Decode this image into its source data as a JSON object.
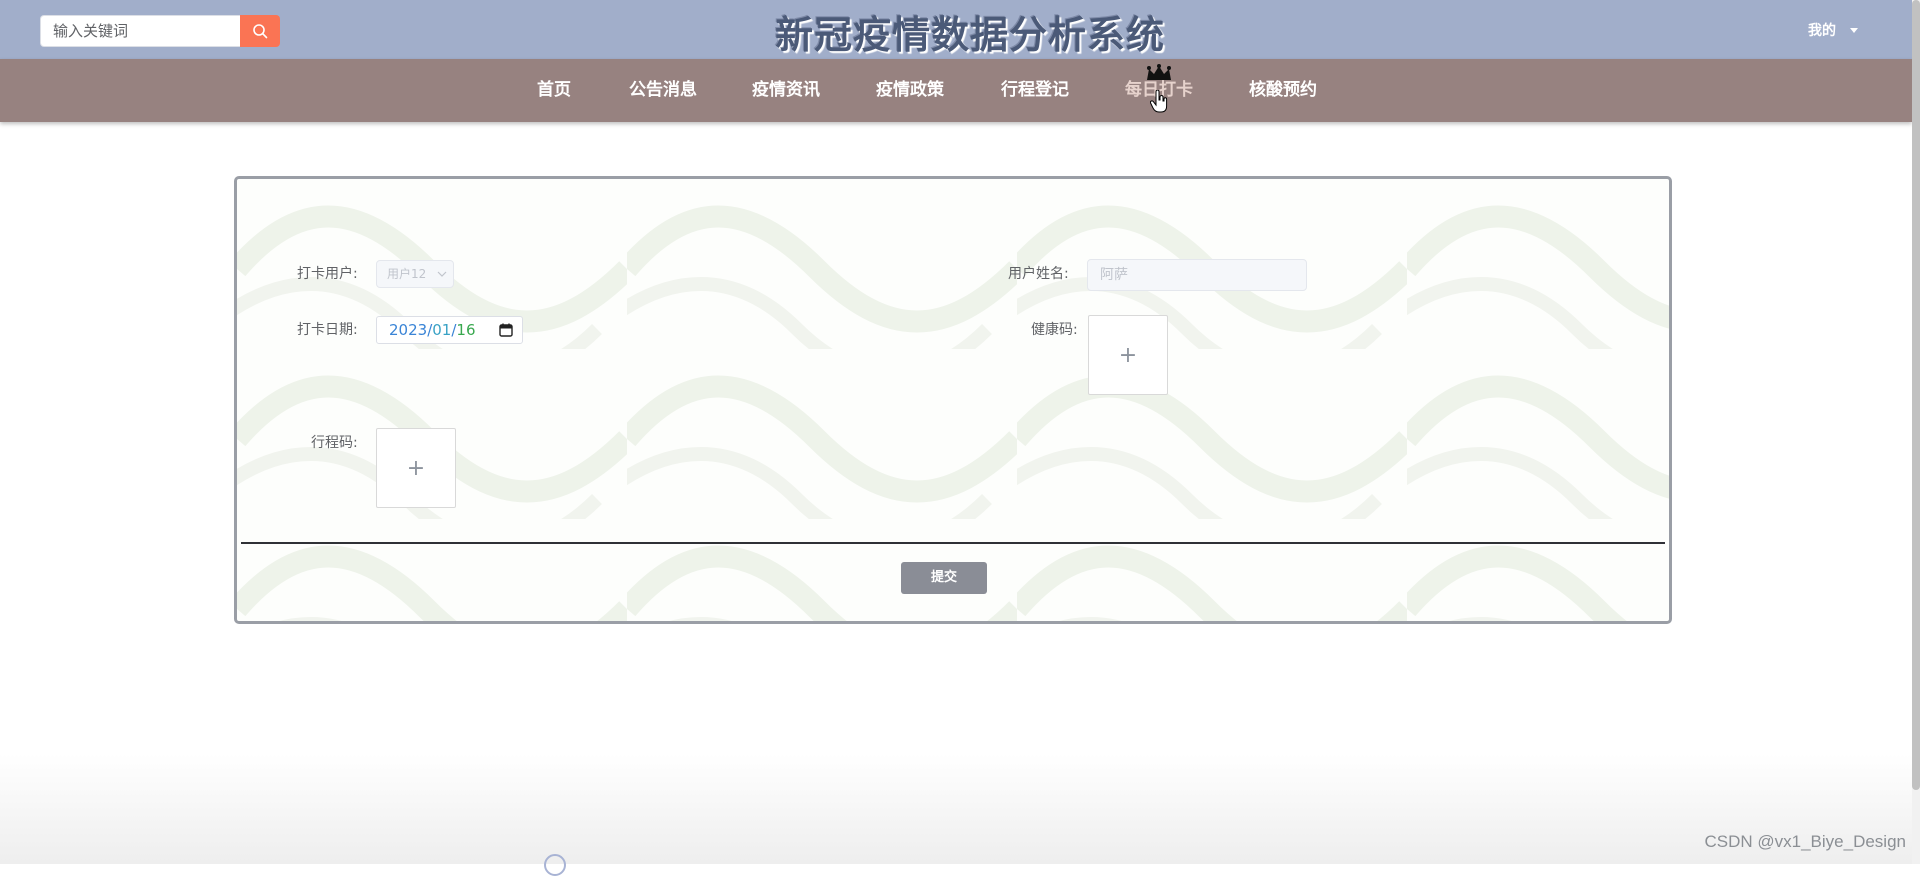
{
  "header": {
    "search_placeholder": "输入关键词",
    "title": "新冠疫情数据分析系统",
    "user_menu_label": "我的"
  },
  "nav": {
    "items": [
      {
        "label": "首页"
      },
      {
        "label": "公告消息"
      },
      {
        "label": "疫情资讯"
      },
      {
        "label": "疫情政策"
      },
      {
        "label": "行程登记"
      },
      {
        "label": "每日打卡",
        "active": true
      },
      {
        "label": "核酸预约"
      }
    ]
  },
  "form": {
    "user_label": "打卡用户:",
    "user_value": "用户12",
    "name_label": "用户姓名:",
    "name_value": "阿萨",
    "date_label": "打卡日期:",
    "date_year": "2023",
    "date_month": "01",
    "date_day": "16",
    "date_sep": "/",
    "health_code_label": "健康码:",
    "itinerary_code_label": "行程码:",
    "upload_plus": "+",
    "submit_label": "提交"
  },
  "watermark": "CSDN @vx1_Biye_Design",
  "colors": {
    "header_bg": "#a1aeca",
    "nav_bg": "#978280",
    "search_button": "#fa7454",
    "submit_button": "#8a8d96"
  },
  "icons": {
    "search": "search-icon",
    "crown": "crown-icon",
    "calendar": "calendar-icon",
    "dropdown": "chevron-down-icon"
  }
}
